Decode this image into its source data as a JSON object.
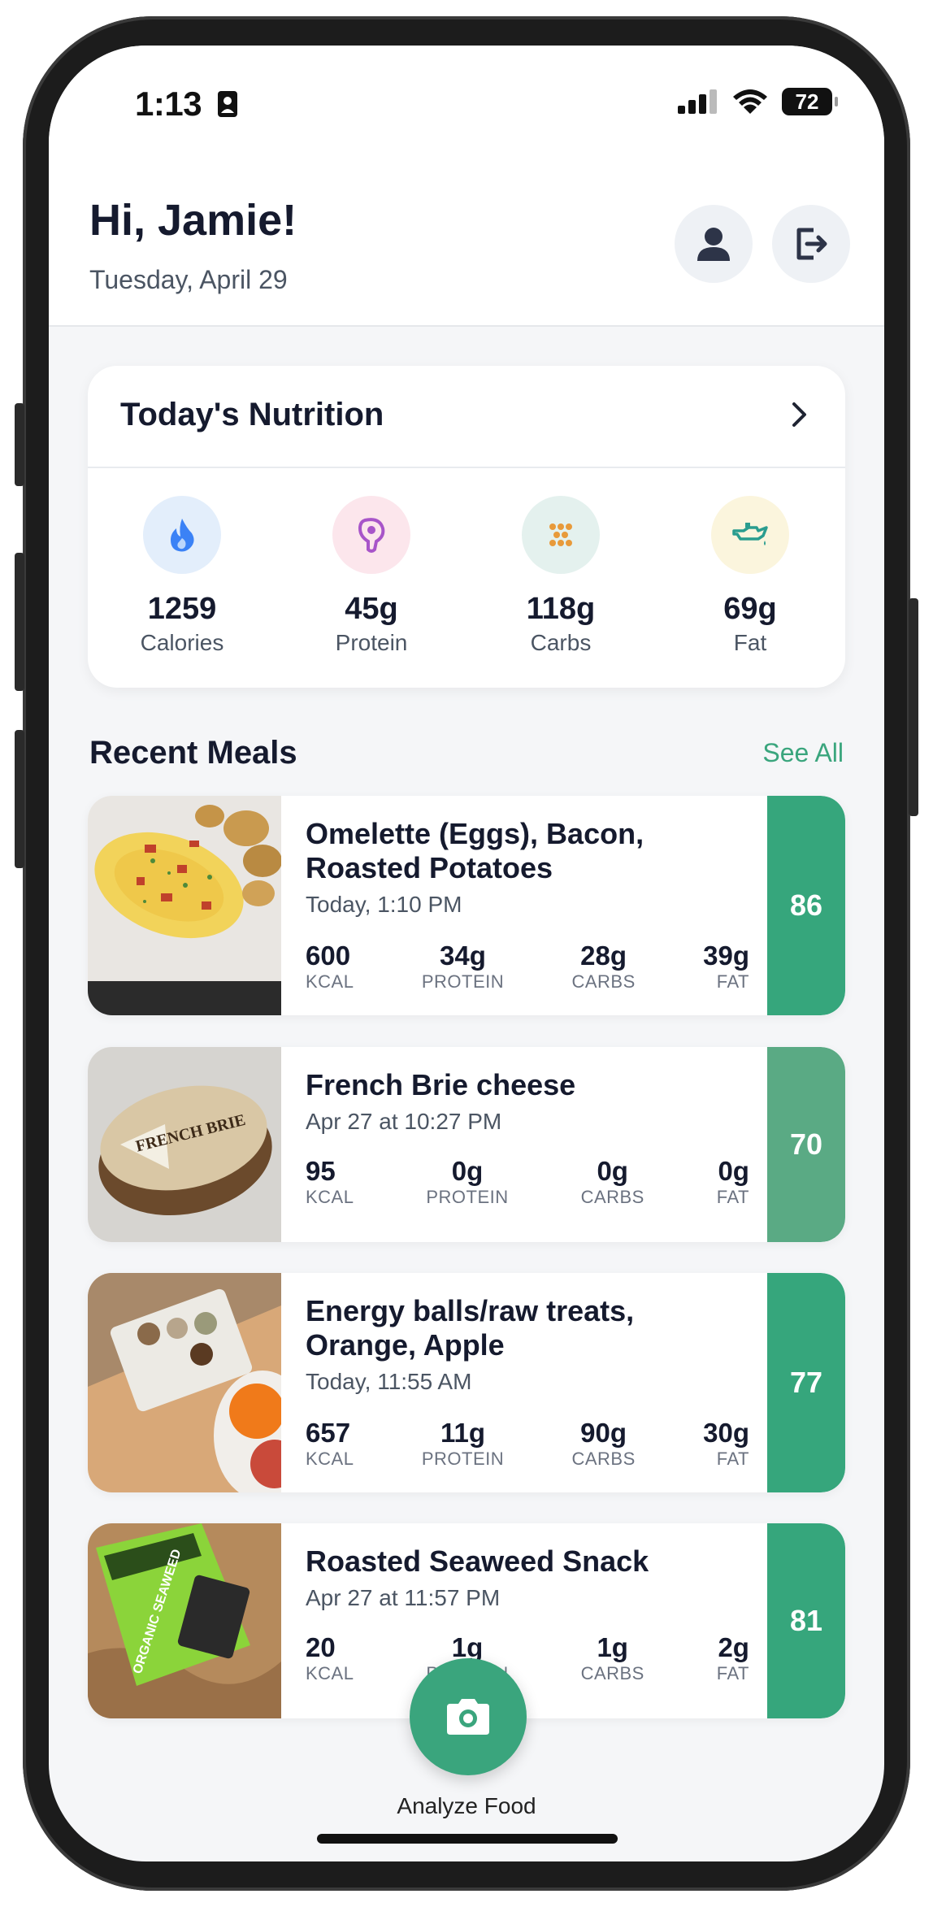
{
  "status_bar": {
    "time": "1:13",
    "battery": "72"
  },
  "header": {
    "greeting": "Hi, Jamie!",
    "date": "Tuesday, April 29"
  },
  "nutrition": {
    "title": "Today's Nutrition",
    "stats": [
      {
        "value": "1259",
        "label": "Calories",
        "icon": "flame-icon",
        "color": "#3b82f6",
        "bg": "#e3eefb"
      },
      {
        "value": "45g",
        "label": "Protein",
        "icon": "meat-icon",
        "color": "#a855c9",
        "bg": "#fce6ec"
      },
      {
        "value": "118g",
        "label": "Carbs",
        "icon": "grain-icon",
        "color": "#e89a3a",
        "bg": "#e4f1ee"
      },
      {
        "value": "69g",
        "label": "Fat",
        "icon": "oil-can-icon",
        "color": "#2a9d8f",
        "bg": "#fbf5dd"
      }
    ]
  },
  "recent": {
    "title": "Recent Meals",
    "see_all": "See All",
    "meals": [
      {
        "name_line1": "Omelette (Eggs), Bacon,",
        "name_line2": "Roasted Potatoes",
        "time": "Today, 1:10 PM",
        "kcal": "600",
        "protein": "34g",
        "carbs": "28g",
        "fat": "39g",
        "score": "86",
        "score_color": "#36a67c"
      },
      {
        "name_line1": "French Brie cheese",
        "name_line2": "",
        "time": "Apr 27 at 10:27 PM",
        "kcal": "95",
        "protein": "0g",
        "carbs": "0g",
        "fat": "0g",
        "score": "70",
        "score_color": "#5aaa84",
        "image_text": "FRENCH BRIE"
      },
      {
        "name_line1": "Energy balls/raw treats,",
        "name_line2": "Orange, Apple",
        "time": "Today, 11:55 AM",
        "kcal": "657",
        "protein": "11g",
        "carbs": "90g",
        "fat": "30g",
        "score": "77",
        "score_color": "#36a67c"
      },
      {
        "name_line1": "Roasted Seaweed Snack",
        "name_line2": "",
        "time": "Apr 27 at 11:57 PM",
        "kcal": "20",
        "protein": "1g",
        "carbs": "1g",
        "fat": "2g",
        "score": "81",
        "score_color": "#36a67c",
        "image_text": "ORGANIC SEAWEED"
      }
    ],
    "labels": {
      "kcal": "KCAL",
      "protein": "PROTEIN",
      "carbs": "CARBS",
      "fat": "FAT"
    }
  },
  "fab": {
    "label": "Analyze Food",
    "icon": "camera-icon"
  },
  "colors": {
    "accent": "#3aa57d",
    "text_dark": "#151a2e"
  }
}
